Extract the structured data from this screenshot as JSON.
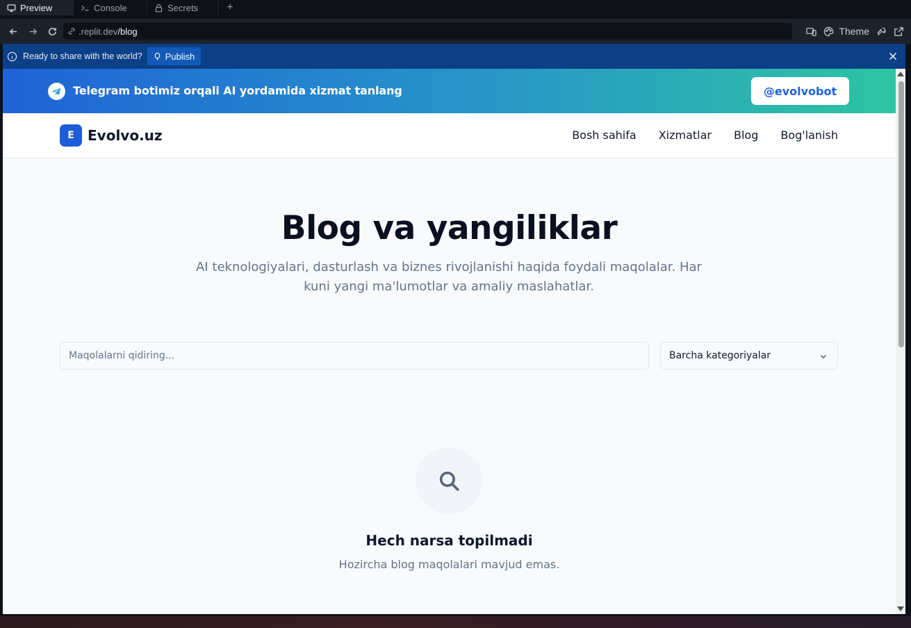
{
  "tabs": [
    {
      "label": "Preview",
      "icon": "monitor-icon",
      "active": true
    },
    {
      "label": "Console",
      "icon": "terminal-icon",
      "active": false
    },
    {
      "label": "Secrets",
      "icon": "lock-icon",
      "active": false
    }
  ],
  "urlbar": {
    "domain": ".replit.dev",
    "path": "/blog",
    "theme_label": "Theme"
  },
  "publish_banner": {
    "message": "Ready to share with the world?",
    "button_label": "Publish"
  },
  "site": {
    "telegram_bar": {
      "text": "Telegram botimiz orqali AI yordamida xizmat tanlang",
      "button_label": "@evolvobot"
    },
    "logo": {
      "badge": "E",
      "name": "Evolvo.uz"
    },
    "nav": [
      "Bosh sahifa",
      "Xizmatlar",
      "Blog",
      "Bog'lanish"
    ],
    "hero": {
      "title": "Blog va yangiliklar",
      "subtitle": "AI teknologiyalari, dasturlash va biznes rivojlanishi haqida foydali maqolalar. Har kuni yangi ma'lumotlar va amaliy maslahatlar."
    },
    "search": {
      "placeholder": "Maqolalarni qidiring...",
      "value": ""
    },
    "category_select": {
      "selected": "Barcha kategoriyalar"
    },
    "empty_state": {
      "title": "Hech narsa topilmadi",
      "message": "Hozircha blog maqolalari mavjud emas."
    }
  },
  "colors": {
    "brand_blue": "#1d5dd8",
    "gradient_start": "#1f63d6",
    "gradient_end": "#2ec4a2",
    "publish_bar": "#0b3f86"
  }
}
